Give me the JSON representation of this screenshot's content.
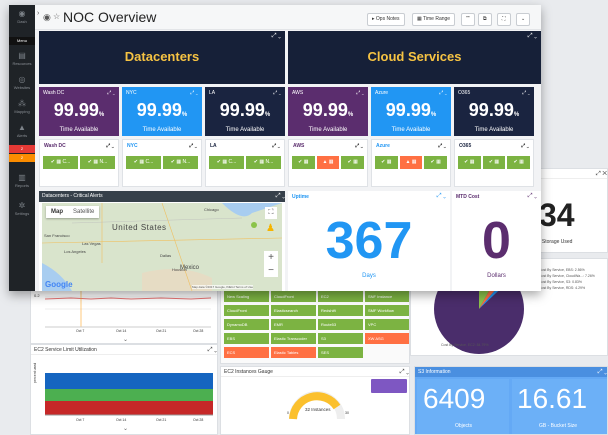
{
  "window": {
    "title": "NOC Overview",
    "toolbar": {
      "ops_notes": "Ops Notes",
      "time_range": "Time Range",
      "btn3": "\"\"",
      "btn4": "",
      "btn5": ""
    }
  },
  "sidebar": {
    "items": [
      {
        "label": "Dash",
        "icon": "dashboard-icon"
      },
      {
        "label": "Menu",
        "icon": "menu-icon"
      },
      {
        "label": "Resources",
        "icon": "server-icon"
      },
      {
        "label": "Websites",
        "icon": "globe-icon"
      },
      {
        "label": "Mapping",
        "icon": "map-icon"
      },
      {
        "label": "Alerts",
        "icon": "alert-icon"
      },
      {
        "label": "2",
        "icon": "badge"
      },
      {
        "label": "2",
        "icon": "badge"
      },
      {
        "label": "Reports",
        "icon": "report-icon"
      },
      {
        "label": "Settings",
        "icon": "gear-icon"
      }
    ]
  },
  "banners": {
    "datacenters": "Datacenters",
    "cloud": "Cloud Services"
  },
  "availability": [
    {
      "name": "Wash DC",
      "value": "99.99",
      "unit": "%",
      "caption": "Time Available",
      "color": "#5b2d6e"
    },
    {
      "name": "NYC",
      "value": "99.99",
      "unit": "%",
      "caption": "Time Available",
      "color": "#2196f3"
    },
    {
      "name": "LA",
      "value": "99.99",
      "unit": "%",
      "caption": "Time Available",
      "color": "#1a2440"
    },
    {
      "name": "AWS",
      "value": "99.99",
      "unit": "%",
      "caption": "Time Available",
      "color": "#5b2d6e"
    },
    {
      "name": "Azure",
      "value": "99.99",
      "unit": "%",
      "caption": "Time Available",
      "color": "#2196f3"
    },
    {
      "name": "O365",
      "value": "99.99",
      "unit": "%",
      "caption": "Time Available",
      "color": "#1a2440"
    }
  ],
  "status_tiles": [
    {
      "name": "Wash DC",
      "boxes": [
        "C...",
        "N..."
      ]
    },
    {
      "name": "NYC",
      "boxes": [
        "C...",
        "N..."
      ]
    },
    {
      "name": "LA",
      "boxes": [
        "C...",
        "N..."
      ]
    },
    {
      "name": "AWS",
      "boxes": [
        "",
        "",
        ""
      ]
    },
    {
      "name": "Azure",
      "boxes": [
        "",
        "",
        ""
      ]
    },
    {
      "name": "O365",
      "boxes": [
        "",
        "",
        ""
      ]
    }
  ],
  "critical": {
    "title": "Datacenters - Critical Alerts",
    "map_btn": "Map",
    "satellite_btn": "Satellite",
    "labels": {
      "us": "United States",
      "mexico": "Mexico",
      "chicago": "Chicago",
      "san_francisco": "San Francisco",
      "las_vegas": "Las Vegas",
      "dallas": "Dallas",
      "houston": "Houston",
      "los_angeles": "Los Angeles"
    },
    "google": "Google",
    "footer": "Map data ©2017 Google, INEGI   Terms of Use"
  },
  "uptime": {
    "title": "Uptime",
    "value": "367",
    "unit": "Days"
  },
  "mtd": {
    "title": "MTD Cost",
    "value": "0",
    "unit": "Dollars"
  },
  "back": {
    "storage_value": "34",
    "storage_caption": "% - Storage Used",
    "pie_legend": [
      "Cost By Service, EBS: 2.56%",
      "Cost By Service, CloudWa...: 7.26%",
      "Cost By Service, S3: 0.83%",
      "Cost By Service, RDS: 4.29%"
    ],
    "pie_caption": "Cost By Service, EC2: 84.79%",
    "ec2_title": "EC2 Service Limit Utilization",
    "gauge_title": "EC2 Instances Gauge",
    "gauge_value": "32",
    "gauge_unit": "Instances",
    "gauge_min": "0",
    "gauge_max": "30",
    "s3_title": "S3 Information",
    "s3_objects": "6409",
    "s3_objects_caption": "Objects",
    "s3_bucket": "16.61",
    "s3_bucket_caption": "GB - Bucket Size",
    "ylabel": "percent used",
    "dates1": [
      "Oct 7",
      "Oct 14",
      "Oct 21",
      "Oct 28"
    ],
    "dates2": [
      "Oct 7",
      "Oct 14",
      "Oct 21",
      "Oct 28"
    ],
    "status_grid": [
      [
        "New Scaling",
        "CloudFront",
        "EC2",
        "SNF Instance"
      ],
      [
        "CloudFront",
        "Elasticsearch",
        "Redshift",
        "SMF Workflow"
      ],
      [
        "DynamoDB",
        "EMR",
        "Route53",
        "VPC"
      ],
      [
        "EBS",
        "Elastic Transcoder",
        "S3",
        "XW ASG"
      ],
      [
        "ECS",
        "Elastic Tables",
        "SES",
        ""
      ]
    ]
  }
}
